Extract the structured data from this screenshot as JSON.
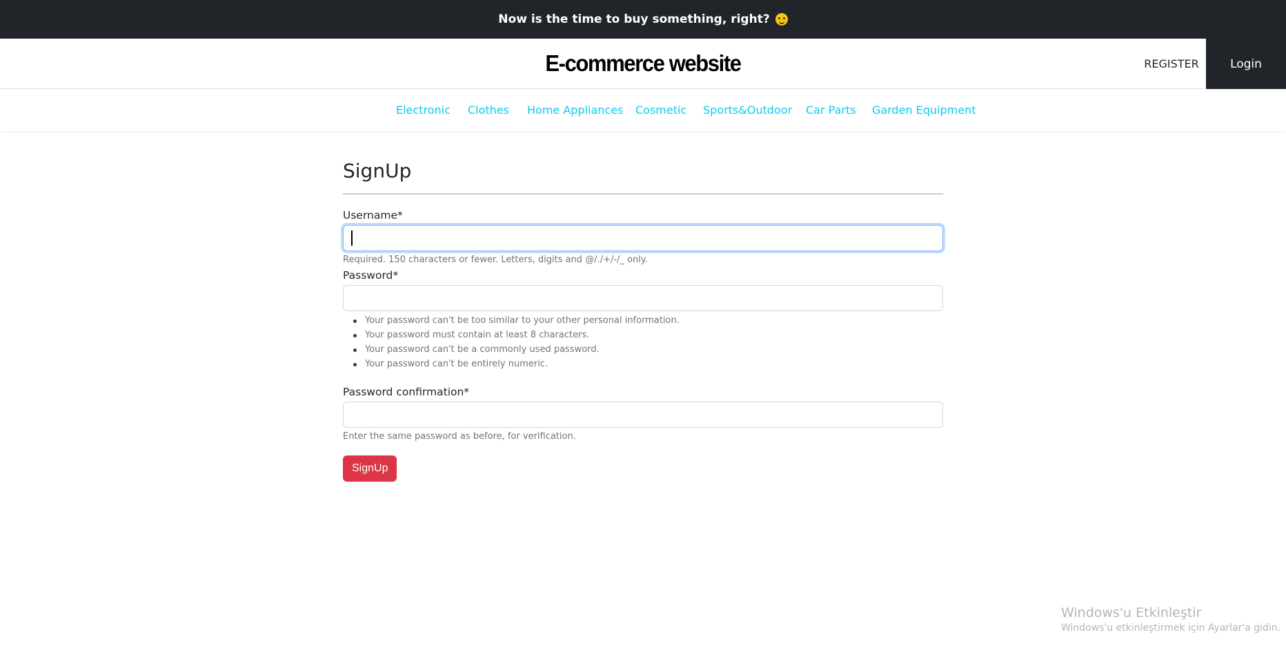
{
  "promo": {
    "text": "Now is the time to buy something, right?",
    "emoji_icon": "smirking-face-emoji"
  },
  "header": {
    "site_title": "E-commerce website",
    "register_label": "REGISTER",
    "login_label": "Login"
  },
  "categories": [
    "Electronic",
    "Clothes",
    "Home Appliances",
    "Cosmetic",
    "Sports&Outdoor",
    "Car Parts",
    "Garden Equipment"
  ],
  "form": {
    "title": "SignUp",
    "username": {
      "label": "Username*",
      "value": "",
      "help": "Required. 150 characters or fewer. Letters, digits and @/./+/-/_ only."
    },
    "password": {
      "label": "Password*",
      "value": "",
      "rules": [
        "Your password can't be too similar to your other personal information.",
        "Your password must contain at least 8 characters.",
        "Your password can't be a commonly used password.",
        "Your password can't be entirely numeric."
      ]
    },
    "password_confirmation": {
      "label": "Password confirmation*",
      "value": "",
      "help": "Enter the same password as before, for verification."
    },
    "submit_label": "SignUp"
  },
  "watermark": {
    "title": "Windows'u Etkinleştir",
    "subtitle": "Windows'u etkinleştirmek için Ayarlar'a gidin."
  },
  "colors": {
    "dark": "#212529",
    "category_link": "#0dcaf0",
    "submit_button": "#dc3545",
    "focus_ring": "#86b7fe"
  }
}
